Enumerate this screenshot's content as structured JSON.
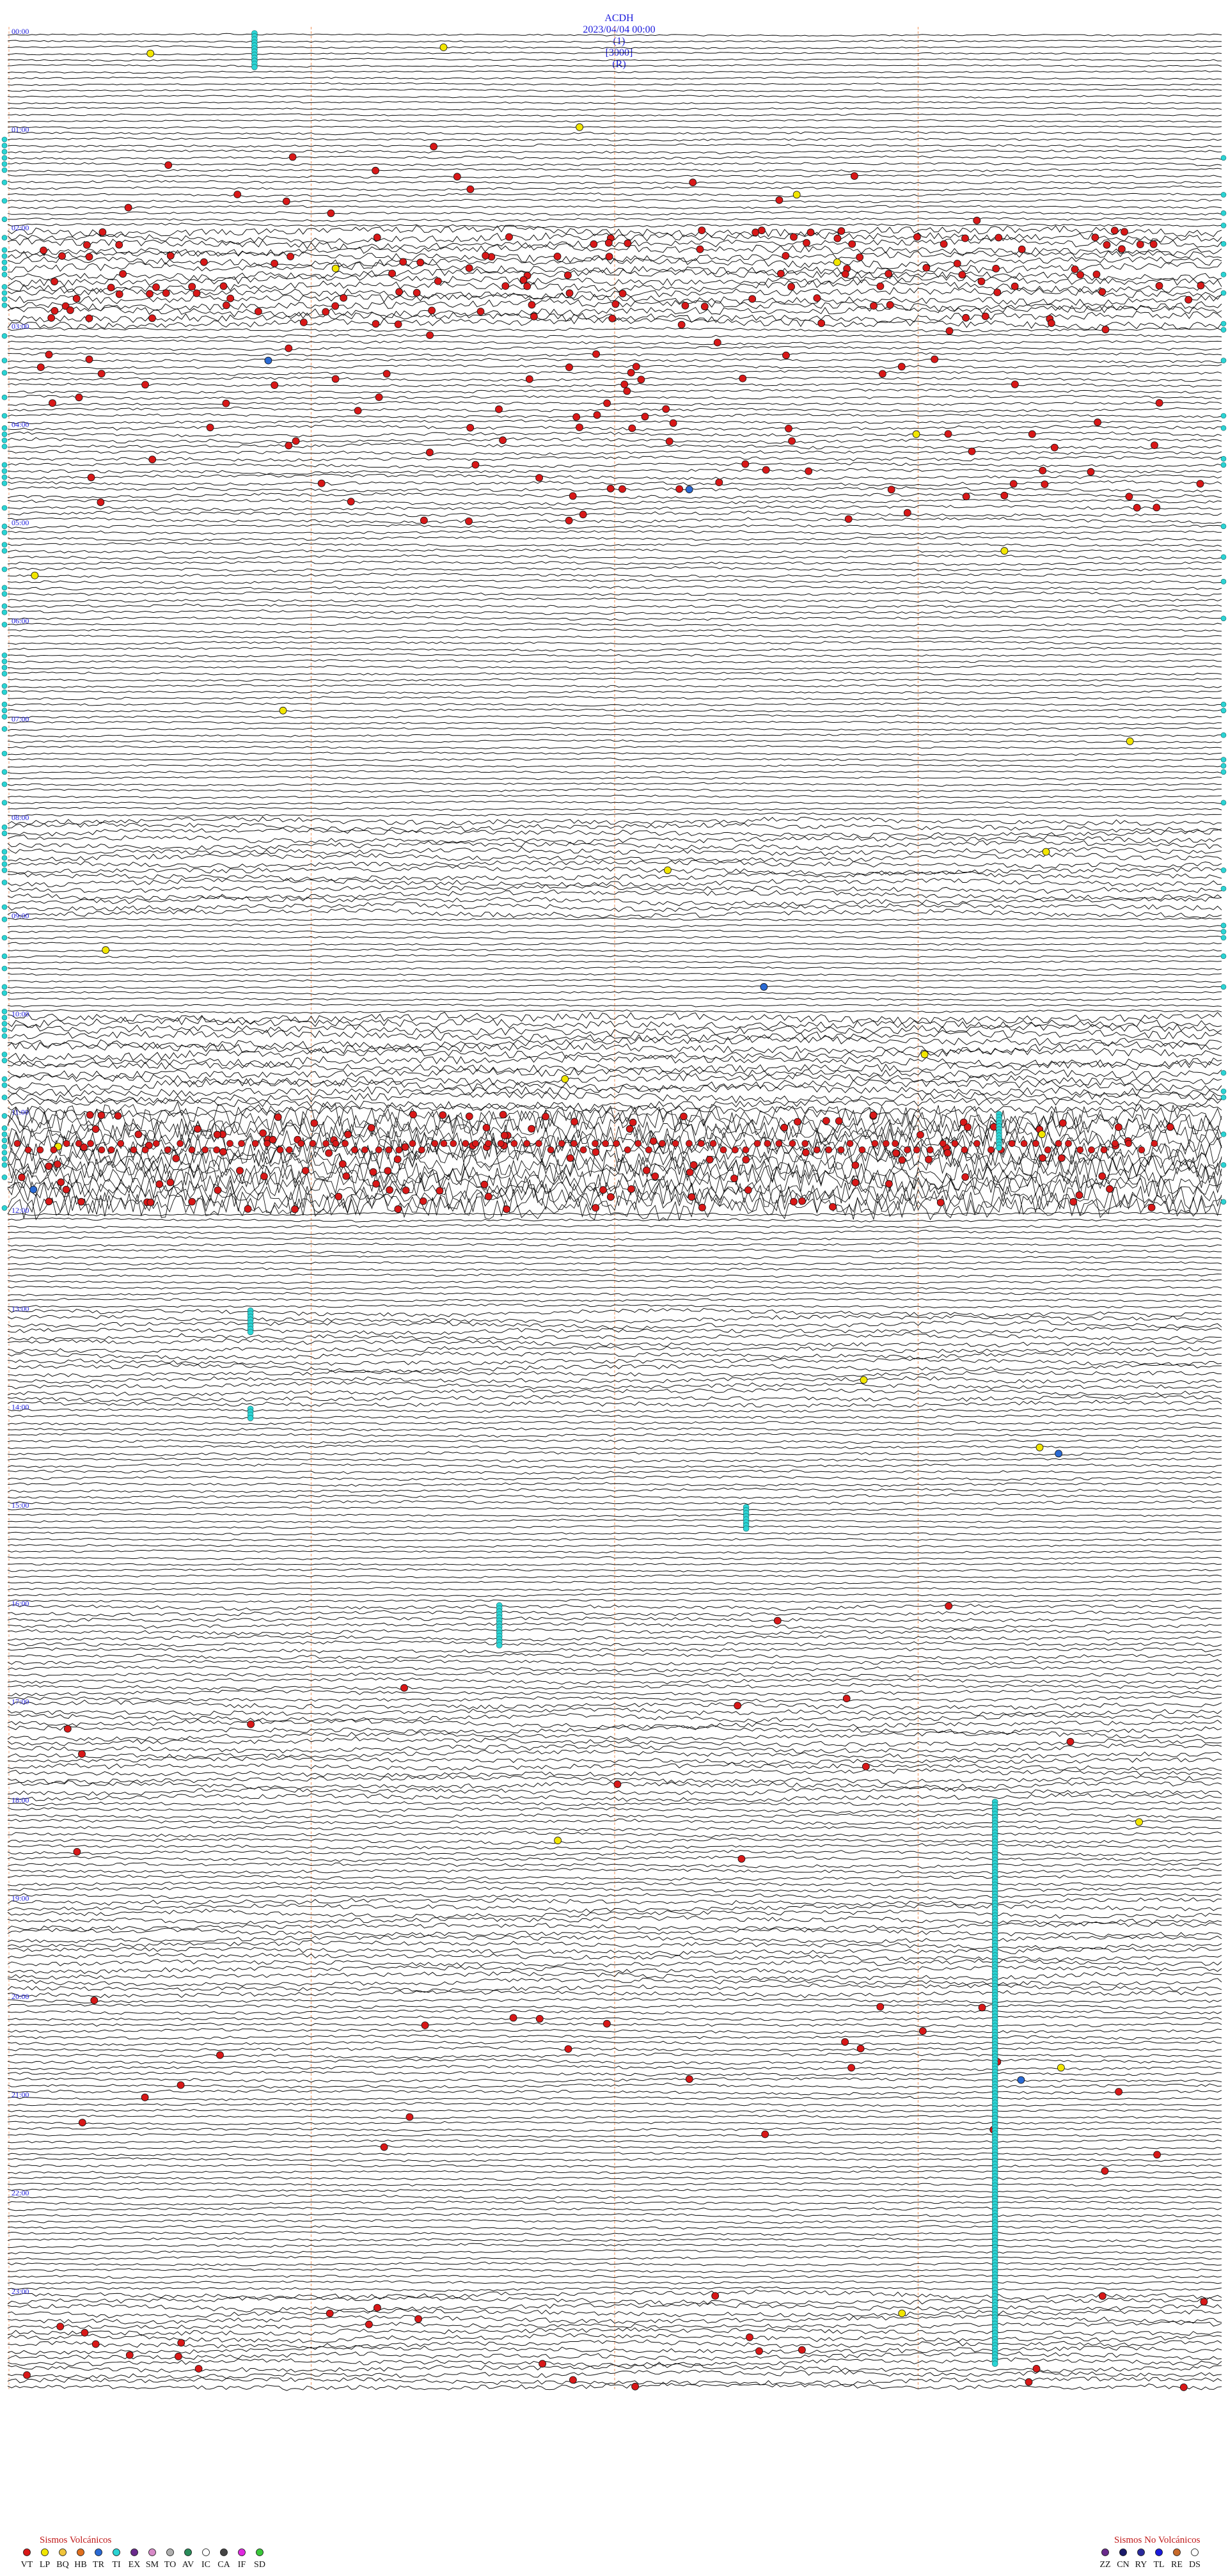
{
  "header": {
    "station": "ACDH",
    "datetime": "2023/04/04 00:00",
    "channel": "(1)",
    "scale": "[3000]",
    "mode": "(R)"
  },
  "chart_data": {
    "type": "seismogram",
    "rows_per_hour": 16,
    "hours": 24,
    "hour_labels": [
      "00:00",
      "01:00",
      "02:00",
      "03:00",
      "04:00",
      "05:00",
      "06:00",
      "07:00",
      "08:00",
      "09:00",
      "10:00",
      "11:00",
      "12:00",
      "13:00",
      "14:00",
      "15:00",
      "16:00",
      "17:00",
      "18:00",
      "19:00",
      "20:00",
      "21:00",
      "22:00",
      "23:00"
    ],
    "minute_markers": [
      0,
      15,
      30,
      45,
      60
    ],
    "amplitude_by_hour": [
      1.0,
      1.4,
      5.5,
      1.6,
      2.0,
      1.6,
      1.3,
      1.2,
      3.5,
      1.2,
      6.0,
      18.0,
      1.4,
      2.8,
      1.6,
      1.2,
      2.2,
      3.2,
      2.0,
      3.0,
      1.8,
      1.4,
      1.5,
      3.2
    ],
    "event_density_by_hour": [
      0.1,
      1.5,
      8.0,
      3.0,
      3.5,
      0.3,
      0.2,
      0.5,
      0.2,
      0.1,
      0.5,
      9.0,
      0.2,
      0.3,
      0.6,
      0.4,
      0.8,
      1.0,
      0.7,
      0.6,
      1.5,
      1.0,
      0.3,
      2.0
    ],
    "event_colors": {
      "VT": "#d81818",
      "LP": "#f2e600",
      "TR": "#2ad4d4",
      "HB": "#2a6ad4"
    },
    "tremor_bursts": [
      {
        "hour": 0,
        "minute": 12.2,
        "rows": 6
      },
      {
        "hour": 11,
        "minute": 49.0,
        "rows": 6
      },
      {
        "hour": 13,
        "minute": 12.0,
        "rows": 4
      },
      {
        "hour": 14,
        "minute": 12.0,
        "rows": 2
      },
      {
        "hour": 15,
        "minute": 36.5,
        "rows": 4
      },
      {
        "hour": 16,
        "minute": 24.3,
        "rows": 7
      },
      {
        "hour": 18,
        "minute": 48.8,
        "rows": 16
      },
      {
        "hour": 19,
        "minute": 48.8,
        "rows": 16
      },
      {
        "hour": 20,
        "minute": 48.8,
        "rows": 16
      },
      {
        "hour": 21,
        "minute": 48.8,
        "rows": 16
      },
      {
        "hour": 22,
        "minute": 48.8,
        "rows": 16
      },
      {
        "hour": 23,
        "minute": 48.8,
        "rows": 12
      }
    ]
  },
  "legend": {
    "volcanic": {
      "title": "Sismos Volcánicos",
      "items": [
        {
          "code": "VT",
          "color": "#d81818"
        },
        {
          "code": "LP",
          "color": "#f2e600"
        },
        {
          "code": "BQ",
          "color": "#f0c43c"
        },
        {
          "code": "HB",
          "color": "#e07020"
        },
        {
          "code": "TR",
          "color": "#2a6ad4"
        },
        {
          "code": "TI",
          "color": "#2ad4d4"
        },
        {
          "code": "EX",
          "color": "#6a2a8c"
        },
        {
          "code": "SM",
          "color": "#d88ac8"
        },
        {
          "code": "TO",
          "color": "#b0b0b0"
        },
        {
          "code": "AV",
          "color": "#2a8c5a"
        },
        {
          "code": "IC",
          "color": "#ffffff"
        },
        {
          "code": "CA",
          "color": "#444444"
        },
        {
          "code": "IF",
          "color": "#e02ae0"
        },
        {
          "code": "SD",
          "color": "#3ac83a"
        }
      ]
    },
    "non_volcanic": {
      "title": "Sismos No Volcánicos",
      "items": [
        {
          "code": "ZZ",
          "color": "#6a2a8c"
        },
        {
          "code": "CN",
          "color": "#1a1a6a"
        },
        {
          "code": "RY",
          "color": "#2a2a9c"
        },
        {
          "code": "TL",
          "color": "#1a1adc"
        },
        {
          "code": "RE",
          "color": "#c86a2a"
        },
        {
          "code": "DS",
          "color": "#ffffff"
        }
      ]
    }
  }
}
